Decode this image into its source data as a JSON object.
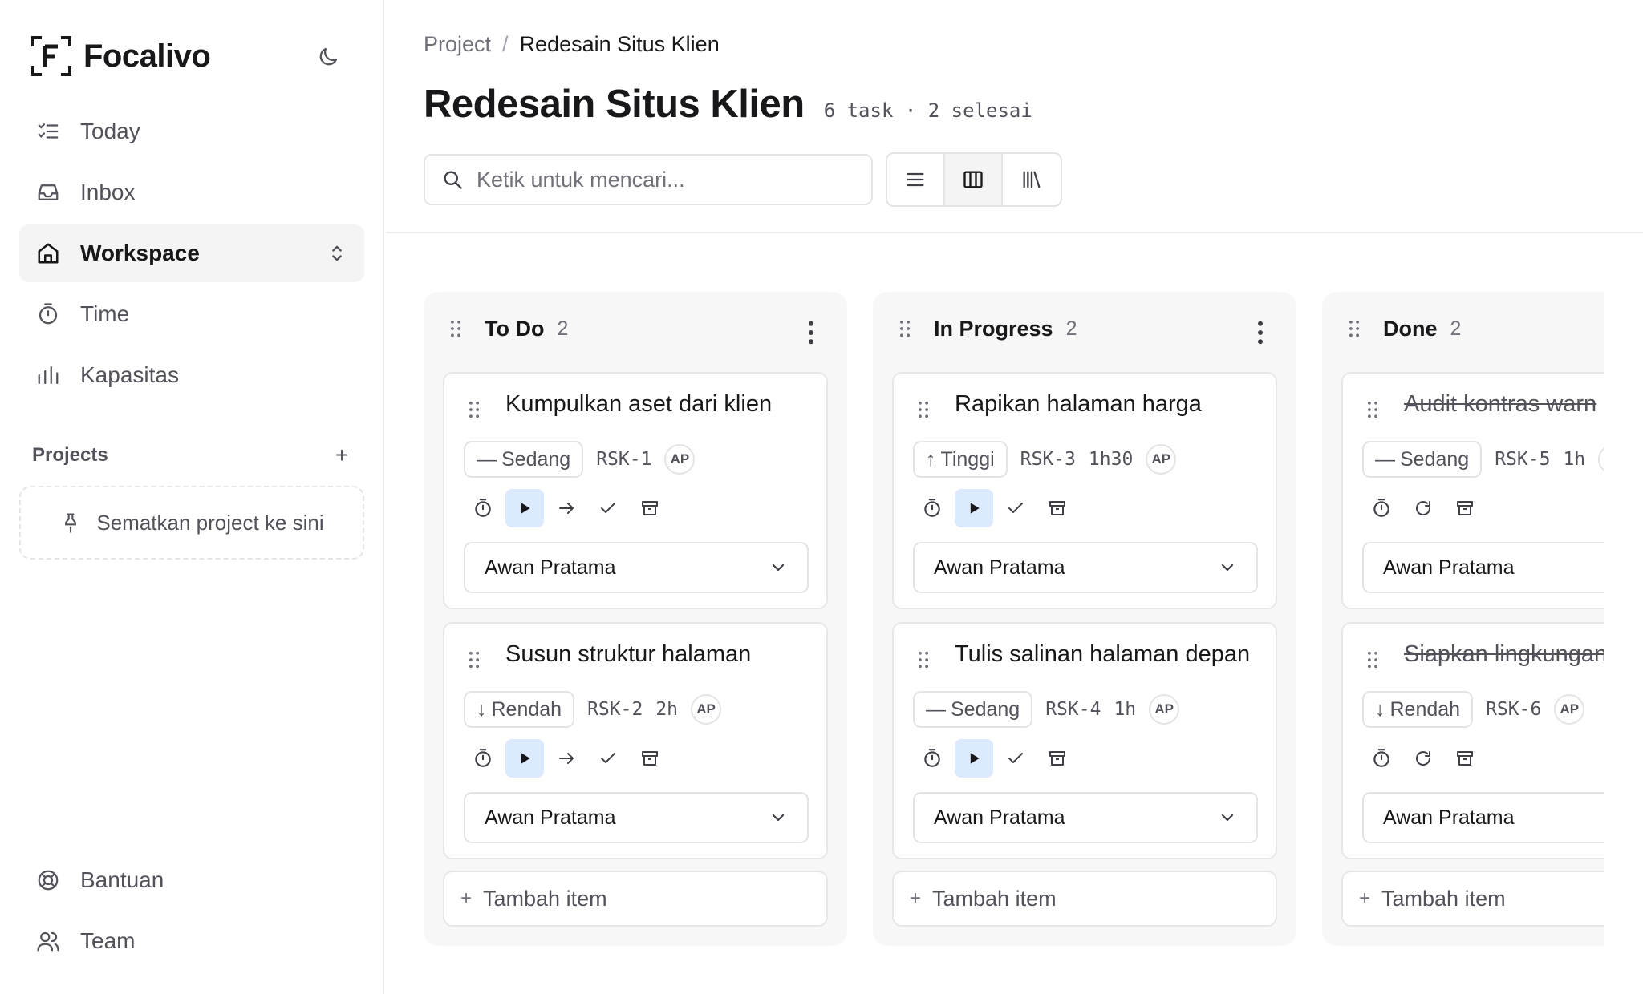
{
  "app": {
    "name": "Focalivo"
  },
  "sidebar": {
    "nav": [
      {
        "label": "Today",
        "icon": "checklist-icon"
      },
      {
        "label": "Inbox",
        "icon": "inbox-icon"
      },
      {
        "label": "Workspace",
        "icon": "home-icon",
        "active": true
      },
      {
        "label": "Time",
        "icon": "timer-icon"
      },
      {
        "label": "Kapasitas",
        "icon": "bar-chart-icon"
      }
    ],
    "projects_title": "Projects",
    "projects_add": "+",
    "pin_hint": "Sematkan project ke sini",
    "bottom_nav": [
      {
        "label": "Bantuan",
        "icon": "lifebuoy-icon"
      },
      {
        "label": "Team",
        "icon": "users-icon"
      }
    ]
  },
  "breadcrumb": {
    "parent": "Project",
    "separator": "/",
    "current": "Redesain Situs Klien"
  },
  "page": {
    "title": "Redesain Situs Klien",
    "meta": "6 task · 2 selesai"
  },
  "search": {
    "placeholder": "Ketik untuk mencari..."
  },
  "views": [
    "list",
    "board",
    "library"
  ],
  "active_view": "board",
  "columns": [
    {
      "title": "To Do",
      "count": "2",
      "cards": [
        {
          "title": "Kumpulkan aset dari klien",
          "priority": "Sedang",
          "priority_glyph": "—",
          "key": "RSK-1",
          "estimate": "",
          "avatar": "AP",
          "assignee": "Awan Pratama",
          "done": false
        },
        {
          "title": "Susun struktur halaman",
          "priority": "Rendah",
          "priority_glyph": "↓",
          "key": "RSK-2",
          "estimate": "2h",
          "avatar": "AP",
          "assignee": "Awan Pratama",
          "done": false
        }
      ],
      "add_label": "Tambah item"
    },
    {
      "title": "In Progress",
      "count": "2",
      "cards": [
        {
          "title": "Rapikan halaman harga",
          "priority": "Tinggi",
          "priority_glyph": "↑",
          "key": "RSK-3",
          "estimate": "1h30",
          "avatar": "AP",
          "assignee": "Awan Pratama",
          "done": false
        },
        {
          "title": "Tulis salinan halaman depan",
          "priority": "Sedang",
          "priority_glyph": "—",
          "key": "RSK-4",
          "estimate": "1h",
          "avatar": "AP",
          "assignee": "Awan Pratama",
          "done": false
        }
      ],
      "add_label": "Tambah item"
    },
    {
      "title": "Done",
      "count": "2",
      "cards": [
        {
          "title": "Audit kontras warn",
          "priority": "Sedang",
          "priority_glyph": "—",
          "key": "RSK-5",
          "estimate": "1h",
          "avatar": "AP",
          "assignee": "Awan Pratama",
          "done": true
        },
        {
          "title": "Siapkan lingkungan",
          "priority": "Rendah",
          "priority_glyph": "↓",
          "key": "RSK-6",
          "estimate": "",
          "avatar": "AP",
          "assignee": "Awan Pratama",
          "done": true
        }
      ],
      "add_label": "Tambah item"
    }
  ],
  "colors": {
    "accent_play_bg": "#dbeafe",
    "column_bg": "#f7f7f8",
    "border": "#e4e4e7",
    "text": "#18181b",
    "muted": "#52525b"
  }
}
